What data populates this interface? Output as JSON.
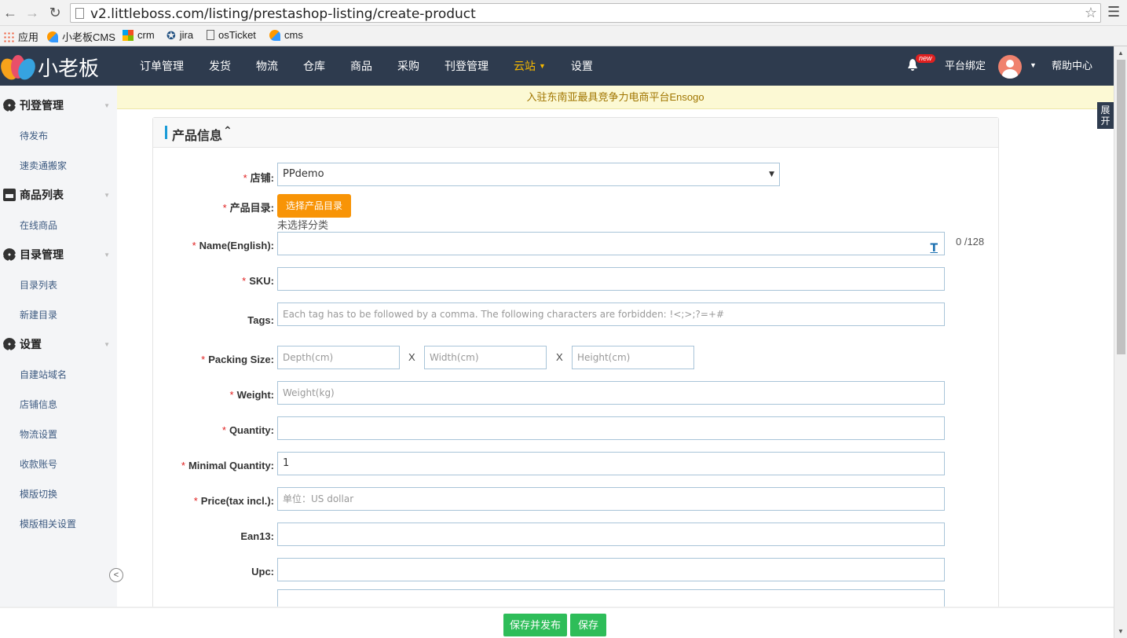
{
  "browser": {
    "url": "v2.littleboss.com/listing/prestashop-listing/create-product",
    "bookmarks": [
      {
        "label": "应用",
        "icon": "apps-icon"
      },
      {
        "label": "小老板CMS",
        "icon": "cms-icon"
      },
      {
        "label": "crm",
        "icon": "crm-icon"
      },
      {
        "label": "jira",
        "icon": "jira-icon"
      },
      {
        "label": "osTicket",
        "icon": "document-icon"
      },
      {
        "label": "cms",
        "icon": "cms-icon"
      }
    ]
  },
  "navbar": {
    "logo_text": "小老板",
    "items": [
      "订单管理",
      "发货",
      "物流",
      "仓库",
      "商品",
      "采购",
      "刊登管理",
      "云站",
      "设置"
    ],
    "active_item": "云站",
    "badge": "new",
    "platform_bind": "平台绑定",
    "help": "帮助中心",
    "active_color": "#f5b800"
  },
  "notice": "入驻东南亚最具竞争力电商平台Ensogo",
  "expand_tab": "展开",
  "sidebar": {
    "sections": [
      {
        "title": "刊登管理",
        "icon": "gear-icon",
        "items": [
          "待发布",
          "速卖通搬家"
        ]
      },
      {
        "title": "商品列表",
        "icon": "store-icon",
        "items": [
          "在线商品"
        ]
      },
      {
        "title": "目录管理",
        "icon": "gear-icon",
        "items": [
          "目录列表",
          "新建目录"
        ]
      },
      {
        "title": "设置",
        "icon": "gear-icon",
        "items": [
          "自建站域名",
          "店铺信息",
          "物流设置",
          "收款账号",
          "模版切换",
          "模版相关设置"
        ]
      }
    ]
  },
  "panel": {
    "title": "产品信息",
    "fields": {
      "shop": {
        "label": "店铺:",
        "value": "PPdemo"
      },
      "category": {
        "label": "产品目录:",
        "button": "选择产品目录",
        "note": "未选择分类"
      },
      "name": {
        "label": "Name(English):",
        "value": "",
        "counter": "0 /128"
      },
      "sku": {
        "label": "SKU:",
        "value": ""
      },
      "tags": {
        "label": "Tags:",
        "placeholder": "Each tag has to be followed by a comma. The following characters are forbidden: !<;>;?=+#"
      },
      "packing": {
        "label": "Packing Size:",
        "depth_ph": "Depth(cm)",
        "width_ph": "Width(cm)",
        "height_ph": "Height(cm)",
        "sep": "X"
      },
      "weight": {
        "label": "Weight:",
        "placeholder": "Weight(kg)"
      },
      "quantity": {
        "label": "Quantity:",
        "value": ""
      },
      "min_quantity": {
        "label": "Minimal Quantity:",
        "value": "1"
      },
      "price": {
        "label": "Price(tax incl.):",
        "placeholder": "单位：US dollar"
      },
      "ean13": {
        "label": "Ean13:",
        "value": ""
      },
      "upc": {
        "label": "Upc:",
        "value": ""
      }
    },
    "required_mark": "*"
  },
  "footer": {
    "save_publish": "保存并发布",
    "save": "保存",
    "button_color": "#2ebd59"
  }
}
